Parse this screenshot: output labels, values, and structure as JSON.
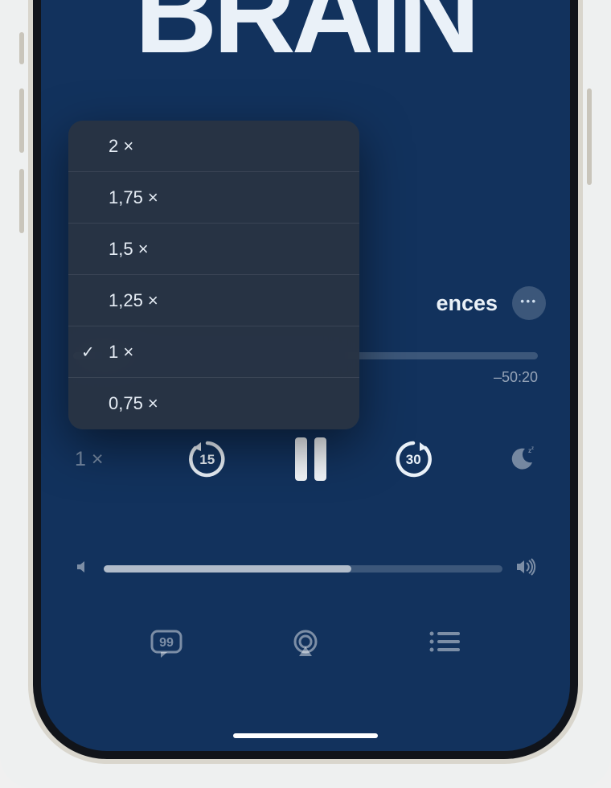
{
  "artwork_title": "BRAIN",
  "episode_partial": "ences",
  "time_remaining": "–50:20",
  "speed_label": "1 ×",
  "skip_back_seconds": "15",
  "skip_forward_seconds": "30",
  "speed_menu": [
    {
      "label": "2 ×",
      "selected": false
    },
    {
      "label": "1,75 ×",
      "selected": false
    },
    {
      "label": "1,5 ×",
      "selected": false
    },
    {
      "label": "1,25 ×",
      "selected": false
    },
    {
      "label": "1 ×",
      "selected": true
    },
    {
      "label": "0,75 ×",
      "selected": false
    }
  ]
}
